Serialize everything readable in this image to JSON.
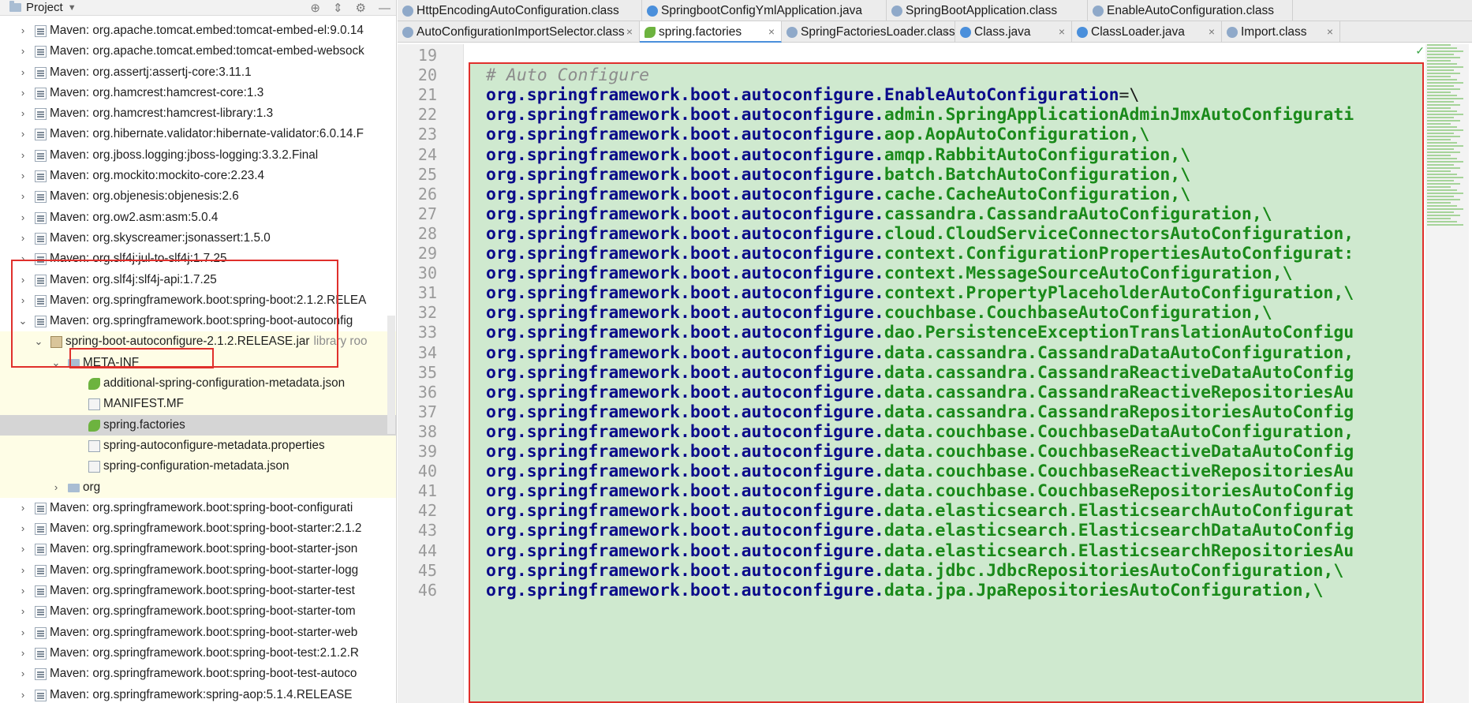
{
  "project": {
    "title": "Project",
    "tools": [
      "⊕",
      "⇕",
      "⚙",
      "—"
    ],
    "tree": [
      {
        "label": "Maven: org.apache.tomcat.embed:tomcat-embed-el:9.0.14",
        "level": 0,
        "arrow": "›",
        "icon": "library"
      },
      {
        "label": "Maven: org.apache.tomcat.embed:tomcat-embed-websock",
        "level": 0,
        "arrow": "›",
        "icon": "library"
      },
      {
        "label": "Maven: org.assertj:assertj-core:3.11.1",
        "level": 0,
        "arrow": "›",
        "icon": "library"
      },
      {
        "label": "Maven: org.hamcrest:hamcrest-core:1.3",
        "level": 0,
        "arrow": "›",
        "icon": "library"
      },
      {
        "label": "Maven: org.hamcrest:hamcrest-library:1.3",
        "level": 0,
        "arrow": "›",
        "icon": "library"
      },
      {
        "label": "Maven: org.hibernate.validator:hibernate-validator:6.0.14.F",
        "level": 0,
        "arrow": "›",
        "icon": "library"
      },
      {
        "label": "Maven: org.jboss.logging:jboss-logging:3.3.2.Final",
        "level": 0,
        "arrow": "›",
        "icon": "library"
      },
      {
        "label": "Maven: org.mockito:mockito-core:2.23.4",
        "level": 0,
        "arrow": "›",
        "icon": "library"
      },
      {
        "label": "Maven: org.objenesis:objenesis:2.6",
        "level": 0,
        "arrow": "›",
        "icon": "library"
      },
      {
        "label": "Maven: org.ow2.asm:asm:5.0.4",
        "level": 0,
        "arrow": "›",
        "icon": "library"
      },
      {
        "label": "Maven: org.skyscreamer:jsonassert:1.5.0",
        "level": 0,
        "arrow": "›",
        "icon": "library"
      },
      {
        "label": "Maven: org.slf4j:jul-to-slf4j:1.7.25",
        "level": 0,
        "arrow": "›",
        "icon": "library"
      },
      {
        "label": "Maven: org.slf4j:slf4j-api:1.7.25",
        "level": 0,
        "arrow": "›",
        "icon": "library"
      },
      {
        "label": "Maven: org.springframework.boot:spring-boot:2.1.2.RELEA",
        "level": 0,
        "arrow": "›",
        "icon": "library"
      },
      {
        "label": "Maven: org.springframework.boot:spring-boot-autoconfig",
        "level": 0,
        "arrow": "⌄",
        "icon": "library"
      },
      {
        "label": "spring-boot-autoconfigure-2.1.2.RELEASE.jar",
        "suffix": "library roo",
        "level": 1,
        "arrow": "⌄",
        "icon": "jar"
      },
      {
        "label": "META-INF",
        "level": 2,
        "arrow": "⌄",
        "icon": "folder"
      },
      {
        "label": "additional-spring-configuration-metadata.json",
        "level": 3,
        "arrow": "",
        "icon": "spring"
      },
      {
        "label": "MANIFEST.MF",
        "level": 3,
        "arrow": "",
        "icon": "mf"
      },
      {
        "label": "spring.factories",
        "level": 3,
        "arrow": "",
        "icon": "spring"
      },
      {
        "label": "spring-autoconfigure-metadata.properties",
        "level": 3,
        "arrow": "",
        "icon": "file"
      },
      {
        "label": "spring-configuration-metadata.json",
        "level": 3,
        "arrow": "",
        "icon": "file"
      },
      {
        "label": "org",
        "level": 2,
        "arrow": "›",
        "icon": "folder"
      },
      {
        "label": "Maven: org.springframework.boot:spring-boot-configurati",
        "level": 0,
        "arrow": "›",
        "icon": "library"
      },
      {
        "label": "Maven: org.springframework.boot:spring-boot-starter:2.1.2",
        "level": 0,
        "arrow": "›",
        "icon": "library"
      },
      {
        "label": "Maven: org.springframework.boot:spring-boot-starter-json",
        "level": 0,
        "arrow": "›",
        "icon": "library"
      },
      {
        "label": "Maven: org.springframework.boot:spring-boot-starter-logg",
        "level": 0,
        "arrow": "›",
        "icon": "library"
      },
      {
        "label": "Maven: org.springframework.boot:spring-boot-starter-test",
        "level": 0,
        "arrow": "›",
        "icon": "library"
      },
      {
        "label": "Maven: org.springframework.boot:spring-boot-starter-tom",
        "level": 0,
        "arrow": "›",
        "icon": "library"
      },
      {
        "label": "Maven: org.springframework.boot:spring-boot-starter-web",
        "level": 0,
        "arrow": "›",
        "icon": "library"
      },
      {
        "label": "Maven: org.springframework.boot:spring-boot-test:2.1.2.R",
        "level": 0,
        "arrow": "›",
        "icon": "library"
      },
      {
        "label": "Maven: org.springframework.boot:spring-boot-test-autoco",
        "level": 0,
        "arrow": "›",
        "icon": "library"
      },
      {
        "label": "Maven: org.springframework:spring-aop:5.1.4.RELEASE",
        "level": 0,
        "arrow": "›",
        "icon": "library"
      }
    ],
    "selected_index": 19
  },
  "editor": {
    "tabs_row1": [
      {
        "label": "HttpEncodingAutoConfiguration.class",
        "icon": "class"
      },
      {
        "label": "SpringbootConfigYmlApplication.java",
        "icon": "java"
      },
      {
        "label": "SpringBootApplication.class",
        "icon": "class"
      },
      {
        "label": "EnableAutoConfiguration.class",
        "icon": "class"
      }
    ],
    "tabs_row2": [
      {
        "label": "AutoConfigurationImportSelector.class",
        "icon": "class",
        "close": "×"
      },
      {
        "label": "spring.factories",
        "icon": "spring",
        "close": "×",
        "active": true
      },
      {
        "label": "SpringFactoriesLoader.class",
        "icon": "class",
        "close": "×"
      },
      {
        "label": "Class.java",
        "icon": "java",
        "close": "×"
      },
      {
        "label": "ClassLoader.java",
        "icon": "java",
        "close": "×"
      },
      {
        "label": "Import.class",
        "icon": "class",
        "close": "×"
      }
    ],
    "line_numbers": [
      "19",
      "20",
      "21",
      "22",
      "23",
      "24",
      "25",
      "26",
      "27",
      "28",
      "29",
      "30",
      "31",
      "32",
      "33",
      "34",
      "35",
      "36",
      "37",
      "38",
      "39",
      "40",
      "41",
      "42",
      "43",
      "44",
      "45",
      "46"
    ],
    "code_lines": [
      {
        "type": "blank",
        "text": ""
      },
      {
        "type": "comment",
        "text": "# Auto Configure"
      },
      {
        "type": "key",
        "key": "org.springframework.boot.autoconfigure.EnableAutoConfiguration",
        "eq": "=\\"
      },
      {
        "type": "value",
        "text": "org.springframework.boot.autoconfigure.admin.SpringApplicationAdminJmxAutoConfigurati"
      },
      {
        "type": "value",
        "text": "org.springframework.boot.autoconfigure.aop.AopAutoConfiguration,\\"
      },
      {
        "type": "value",
        "text": "org.springframework.boot.autoconfigure.amqp.RabbitAutoConfiguration,\\"
      },
      {
        "type": "value",
        "text": "org.springframework.boot.autoconfigure.batch.BatchAutoConfiguration,\\"
      },
      {
        "type": "value",
        "text": "org.springframework.boot.autoconfigure.cache.CacheAutoConfiguration,\\"
      },
      {
        "type": "value",
        "text": "org.springframework.boot.autoconfigure.cassandra.CassandraAutoConfiguration,\\"
      },
      {
        "type": "value",
        "text": "org.springframework.boot.autoconfigure.cloud.CloudServiceConnectorsAutoConfiguration,"
      },
      {
        "type": "value",
        "text": "org.springframework.boot.autoconfigure.context.ConfigurationPropertiesAutoConfigurat:"
      },
      {
        "type": "value",
        "text": "org.springframework.boot.autoconfigure.context.MessageSourceAutoConfiguration,\\"
      },
      {
        "type": "value",
        "text": "org.springframework.boot.autoconfigure.context.PropertyPlaceholderAutoConfiguration,\\"
      },
      {
        "type": "value",
        "text": "org.springframework.boot.autoconfigure.couchbase.CouchbaseAutoConfiguration,\\"
      },
      {
        "type": "value",
        "text": "org.springframework.boot.autoconfigure.dao.PersistenceExceptionTranslationAutoConfigu"
      },
      {
        "type": "value",
        "text": "org.springframework.boot.autoconfigure.data.cassandra.CassandraDataAutoConfiguration,"
      },
      {
        "type": "value",
        "text": "org.springframework.boot.autoconfigure.data.cassandra.CassandraReactiveDataAutoConfig"
      },
      {
        "type": "value",
        "text": "org.springframework.boot.autoconfigure.data.cassandra.CassandraReactiveRepositoriesAu"
      },
      {
        "type": "value",
        "text": "org.springframework.boot.autoconfigure.data.cassandra.CassandraRepositoriesAutoConfig"
      },
      {
        "type": "value",
        "text": "org.springframework.boot.autoconfigure.data.couchbase.CouchbaseDataAutoConfiguration,"
      },
      {
        "type": "value",
        "text": "org.springframework.boot.autoconfigure.data.couchbase.CouchbaseReactiveDataAutoConfig"
      },
      {
        "type": "value",
        "text": "org.springframework.boot.autoconfigure.data.couchbase.CouchbaseReactiveRepositoriesAu"
      },
      {
        "type": "value",
        "text": "org.springframework.boot.autoconfigure.data.couchbase.CouchbaseRepositoriesAutoConfig"
      },
      {
        "type": "value",
        "text": "org.springframework.boot.autoconfigure.data.elasticsearch.ElasticsearchAutoConfigurat"
      },
      {
        "type": "value",
        "text": "org.springframework.boot.autoconfigure.data.elasticsearch.ElasticsearchDataAutoConfig"
      },
      {
        "type": "value",
        "text": "org.springframework.boot.autoconfigure.data.elasticsearch.ElasticsearchRepositoriesAu"
      },
      {
        "type": "value",
        "text": "org.springframework.boot.autoconfigure.data.jdbc.JdbcRepositoriesAutoConfiguration,\\"
      },
      {
        "type": "value",
        "text": "org.springframework.boot.autoconfigure.data.jpa.JpaRepositoriesAutoConfiguration,\\"
      }
    ],
    "inspection_status": "✓"
  },
  "colors": {
    "highlight_red": "#e0302c",
    "code_background": "#cfe9cf",
    "key_color": "#0b0b8a",
    "value_color": "#1a8a1a"
  }
}
